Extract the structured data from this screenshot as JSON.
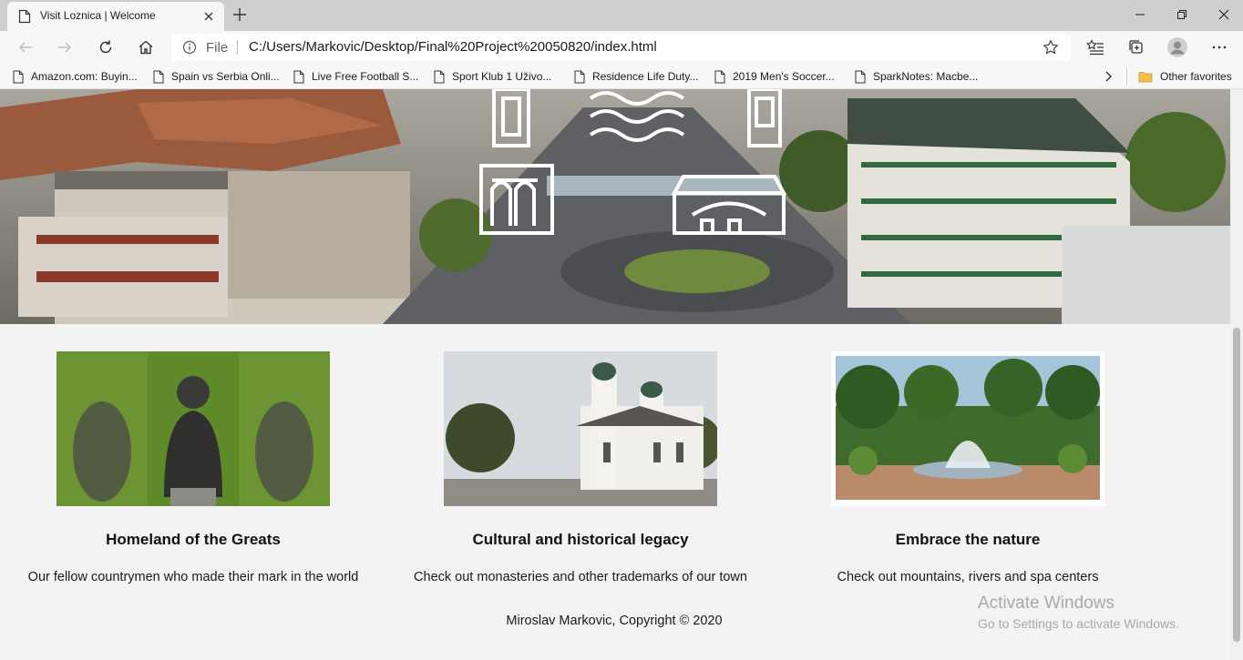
{
  "browser": {
    "tab_title": "Visit Loznica | Welcome",
    "address_scheme": "File",
    "address_url": "C:/Users/Markovic/Desktop/Final%20Project%20050820/index.html",
    "bookmarks": [
      "Amazon.com: Buyin...",
      "Spain vs Serbia Onli...",
      "Live Free Football S...",
      "Sport Klub 1 Uživo...",
      "Residence Life Duty...",
      "2019 Men's Soccer...",
      "SparkNotes: Macbe..."
    ],
    "other_favorites": "Other favorites"
  },
  "cards": [
    {
      "title": "Homeland of the Greats",
      "description": "Our fellow countrymen who made their mark in the world"
    },
    {
      "title": "Cultural and historical legacy",
      "description": "Check out monasteries and other trademarks of our town"
    },
    {
      "title": "Embrace the nature",
      "description": "Check out mountains, rivers and spa centers"
    }
  ],
  "footer": {
    "copyright": "Miroslav Markovic, Copyright © 2020"
  },
  "watermark": {
    "line1": "Activate Windows",
    "line2": "Go to Settings to activate Windows."
  }
}
